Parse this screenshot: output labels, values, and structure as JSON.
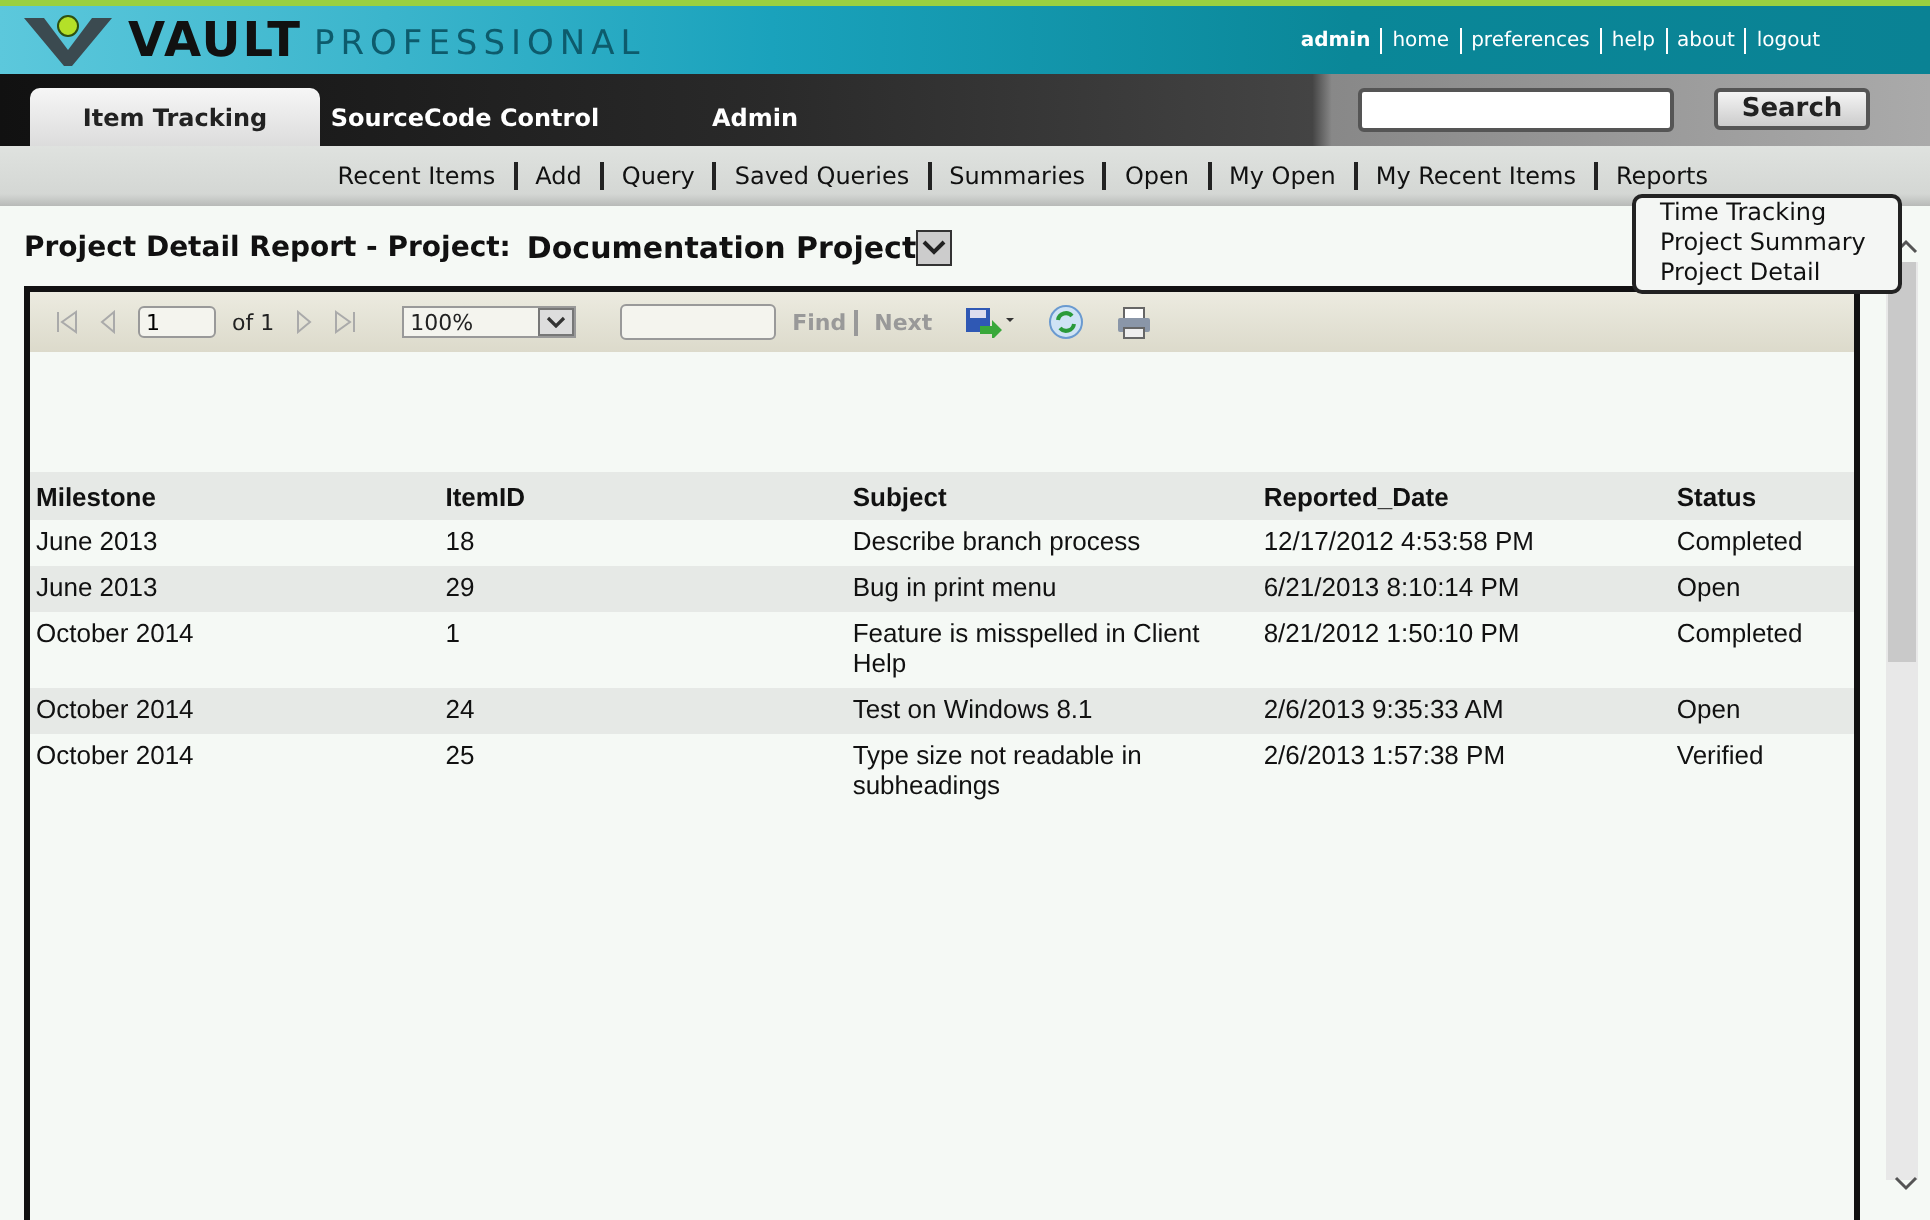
{
  "header": {
    "logo_main": "VAULT",
    "logo_sub": "PROFESSIONAL",
    "user_links": [
      "admin",
      "home",
      "preferences",
      "help",
      "about",
      "logout"
    ]
  },
  "tabs": [
    {
      "label": "Item Tracking",
      "selected": true
    },
    {
      "label": "SourceCode Control",
      "selected": false
    },
    {
      "label": "Admin",
      "selected": false
    }
  ],
  "search": {
    "button": "Search"
  },
  "subnav": {
    "items": [
      "Recent Items",
      "Add",
      "Query",
      "Saved Queries",
      "Summaries",
      "Open",
      "My Open",
      "My Recent Items",
      "Reports"
    ],
    "reports_menu": [
      "Time Tracking",
      "Project Summary",
      "Project Detail"
    ]
  },
  "report": {
    "title": "Project Detail Report - Project:",
    "project": "Documentation Project",
    "toolbar": {
      "page": "1",
      "of": "of 1",
      "zoom": "100%",
      "find": "Find",
      "next": "Next"
    },
    "table": {
      "columns": [
        "Milestone",
        "ItemID",
        "Subject",
        "Reported_Date",
        "Status"
      ],
      "rows": [
        [
          "June 2013",
          "18",
          "Describe branch process",
          "12/17/2012 4:53:58 PM",
          "Completed"
        ],
        [
          "June 2013",
          "29",
          "Bug in print menu",
          "6/21/2013 8:10:14 PM",
          "Open"
        ],
        [
          "October 2014",
          "1",
          "Feature is misspelled in Client Help",
          "8/21/2012 1:50:10 PM",
          "Completed"
        ],
        [
          "October 2014",
          "24",
          "Test on Windows 8.1",
          "2/6/2013 9:35:33 AM",
          "Open"
        ],
        [
          "October 2014",
          "25",
          "Type size not readable in subheadings",
          "2/6/2013 1:57:38 PM",
          "Verified"
        ]
      ]
    }
  }
}
